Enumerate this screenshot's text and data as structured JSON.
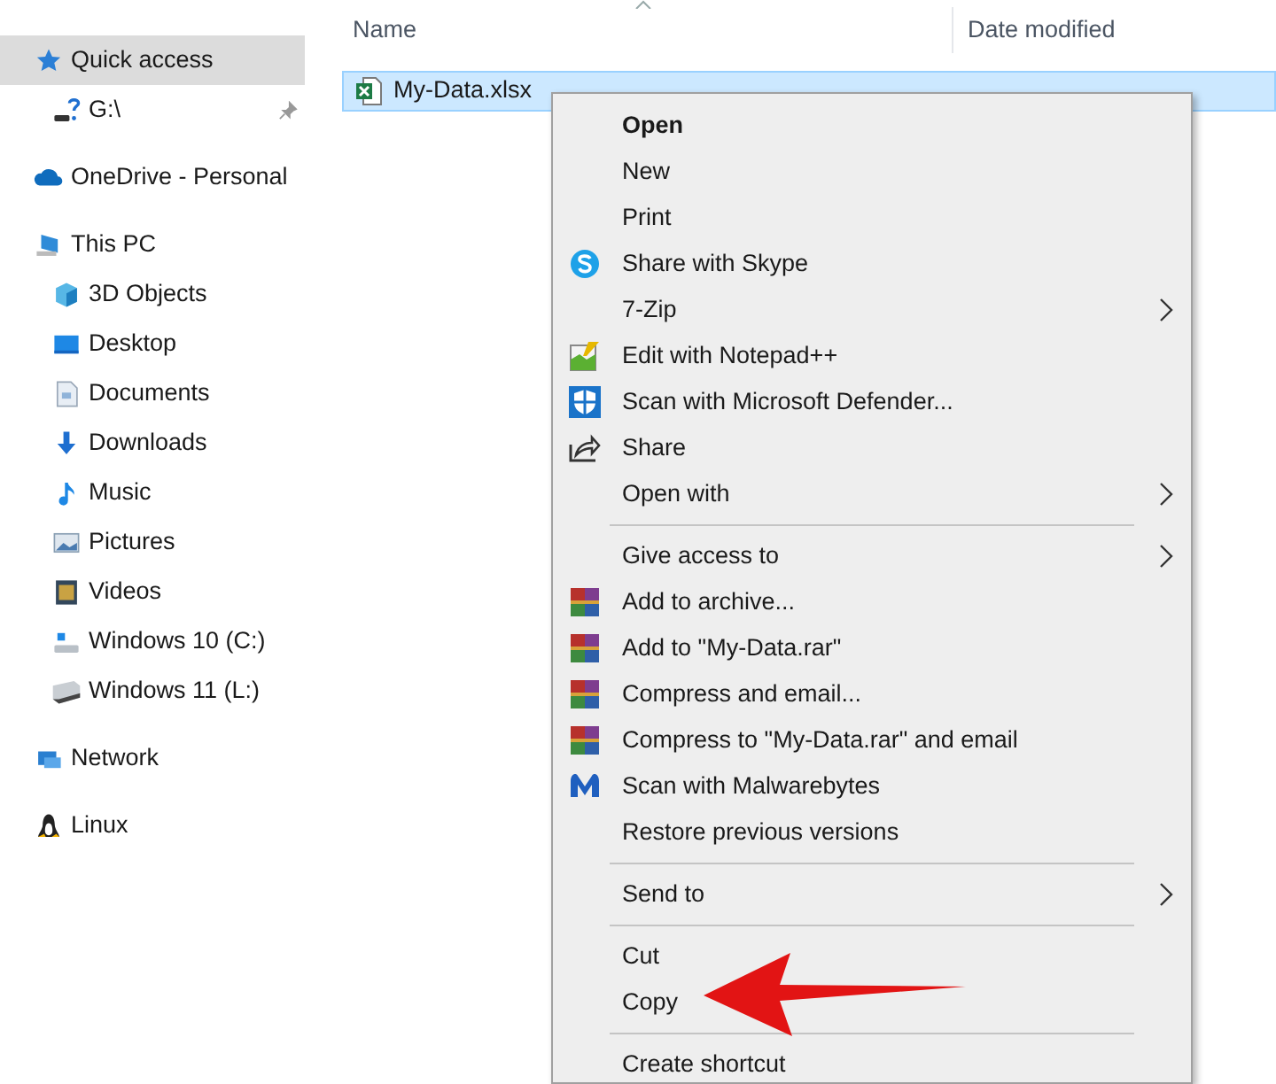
{
  "sidebar": {
    "items": [
      {
        "label": "Quick access",
        "kind": "star",
        "selected": true,
        "children": [
          {
            "label": "G:\\",
            "kind": "unknown-drive",
            "selected": false,
            "pinned": true
          }
        ]
      },
      {
        "label": "OneDrive - Personal",
        "kind": "cloud",
        "selected": false
      },
      {
        "label": "This PC",
        "kind": "computer",
        "selected": false,
        "children": [
          {
            "label": "3D Objects",
            "kind": "cube",
            "selected": false
          },
          {
            "label": "Desktop",
            "kind": "desktop",
            "selected": false
          },
          {
            "label": "Documents",
            "kind": "document",
            "selected": false
          },
          {
            "label": "Downloads",
            "kind": "download",
            "selected": false
          },
          {
            "label": "Music",
            "kind": "music",
            "selected": false
          },
          {
            "label": "Pictures",
            "kind": "pictures",
            "selected": false
          },
          {
            "label": "Videos",
            "kind": "videos",
            "selected": false
          },
          {
            "label": "Windows 10 (C:)",
            "kind": "system-drive",
            "selected": false
          },
          {
            "label": "Windows 11 (L:)",
            "kind": "drive",
            "selected": false
          }
        ]
      },
      {
        "label": "Network",
        "kind": "network",
        "selected": false
      },
      {
        "label": "Linux",
        "kind": "penguin",
        "selected": false
      }
    ]
  },
  "file_list": {
    "columns": [
      "Name",
      "Date modified"
    ],
    "rows": [
      {
        "name": "My-Data.xlsx",
        "selected": true
      }
    ]
  },
  "context_menu": {
    "items": [
      {
        "kind": "plain",
        "label": "Open",
        "bold": true,
        "submenu": false
      },
      {
        "kind": "plain",
        "label": "New",
        "bold": false,
        "submenu": false
      },
      {
        "kind": "plain",
        "label": "Print",
        "bold": false,
        "submenu": false
      },
      {
        "kind": "skype",
        "label": "Share with Skype",
        "bold": false,
        "submenu": false
      },
      {
        "kind": "plain",
        "label": "7-Zip",
        "bold": false,
        "submenu": true
      },
      {
        "kind": "notepad",
        "label": "Edit with Notepad++",
        "bold": false,
        "submenu": false
      },
      {
        "kind": "defender",
        "label": "Scan with Microsoft Defender...",
        "bold": false,
        "submenu": false
      },
      {
        "kind": "share",
        "label": "Share",
        "bold": false,
        "submenu": false
      },
      {
        "kind": "plain",
        "label": "Open with",
        "bold": false,
        "submenu": true
      },
      {
        "kind": "separator"
      },
      {
        "kind": "plain",
        "label": "Give access to",
        "bold": false,
        "submenu": true
      },
      {
        "kind": "rar",
        "label": "Add to archive...",
        "bold": false,
        "submenu": false
      },
      {
        "kind": "rar",
        "label": "Add to \"My-Data.rar\"",
        "bold": false,
        "submenu": false
      },
      {
        "kind": "rar",
        "label": "Compress and email...",
        "bold": false,
        "submenu": false
      },
      {
        "kind": "rar",
        "label": "Compress to \"My-Data.rar\" and email",
        "bold": false,
        "submenu": false
      },
      {
        "kind": "malwarebytes",
        "label": "Scan with Malwarebytes",
        "bold": false,
        "submenu": false
      },
      {
        "kind": "plain",
        "label": "Restore previous versions",
        "bold": false,
        "submenu": false
      },
      {
        "kind": "separator"
      },
      {
        "kind": "plain",
        "label": "Send to",
        "bold": false,
        "submenu": true
      },
      {
        "kind": "separator"
      },
      {
        "kind": "plain",
        "label": "Cut",
        "bold": false,
        "submenu": false
      },
      {
        "kind": "plain",
        "label": "Copy",
        "bold": false,
        "submenu": false
      },
      {
        "kind": "separator"
      },
      {
        "kind": "plain",
        "label": "Create shortcut",
        "bold": false,
        "submenu": false
      }
    ]
  }
}
